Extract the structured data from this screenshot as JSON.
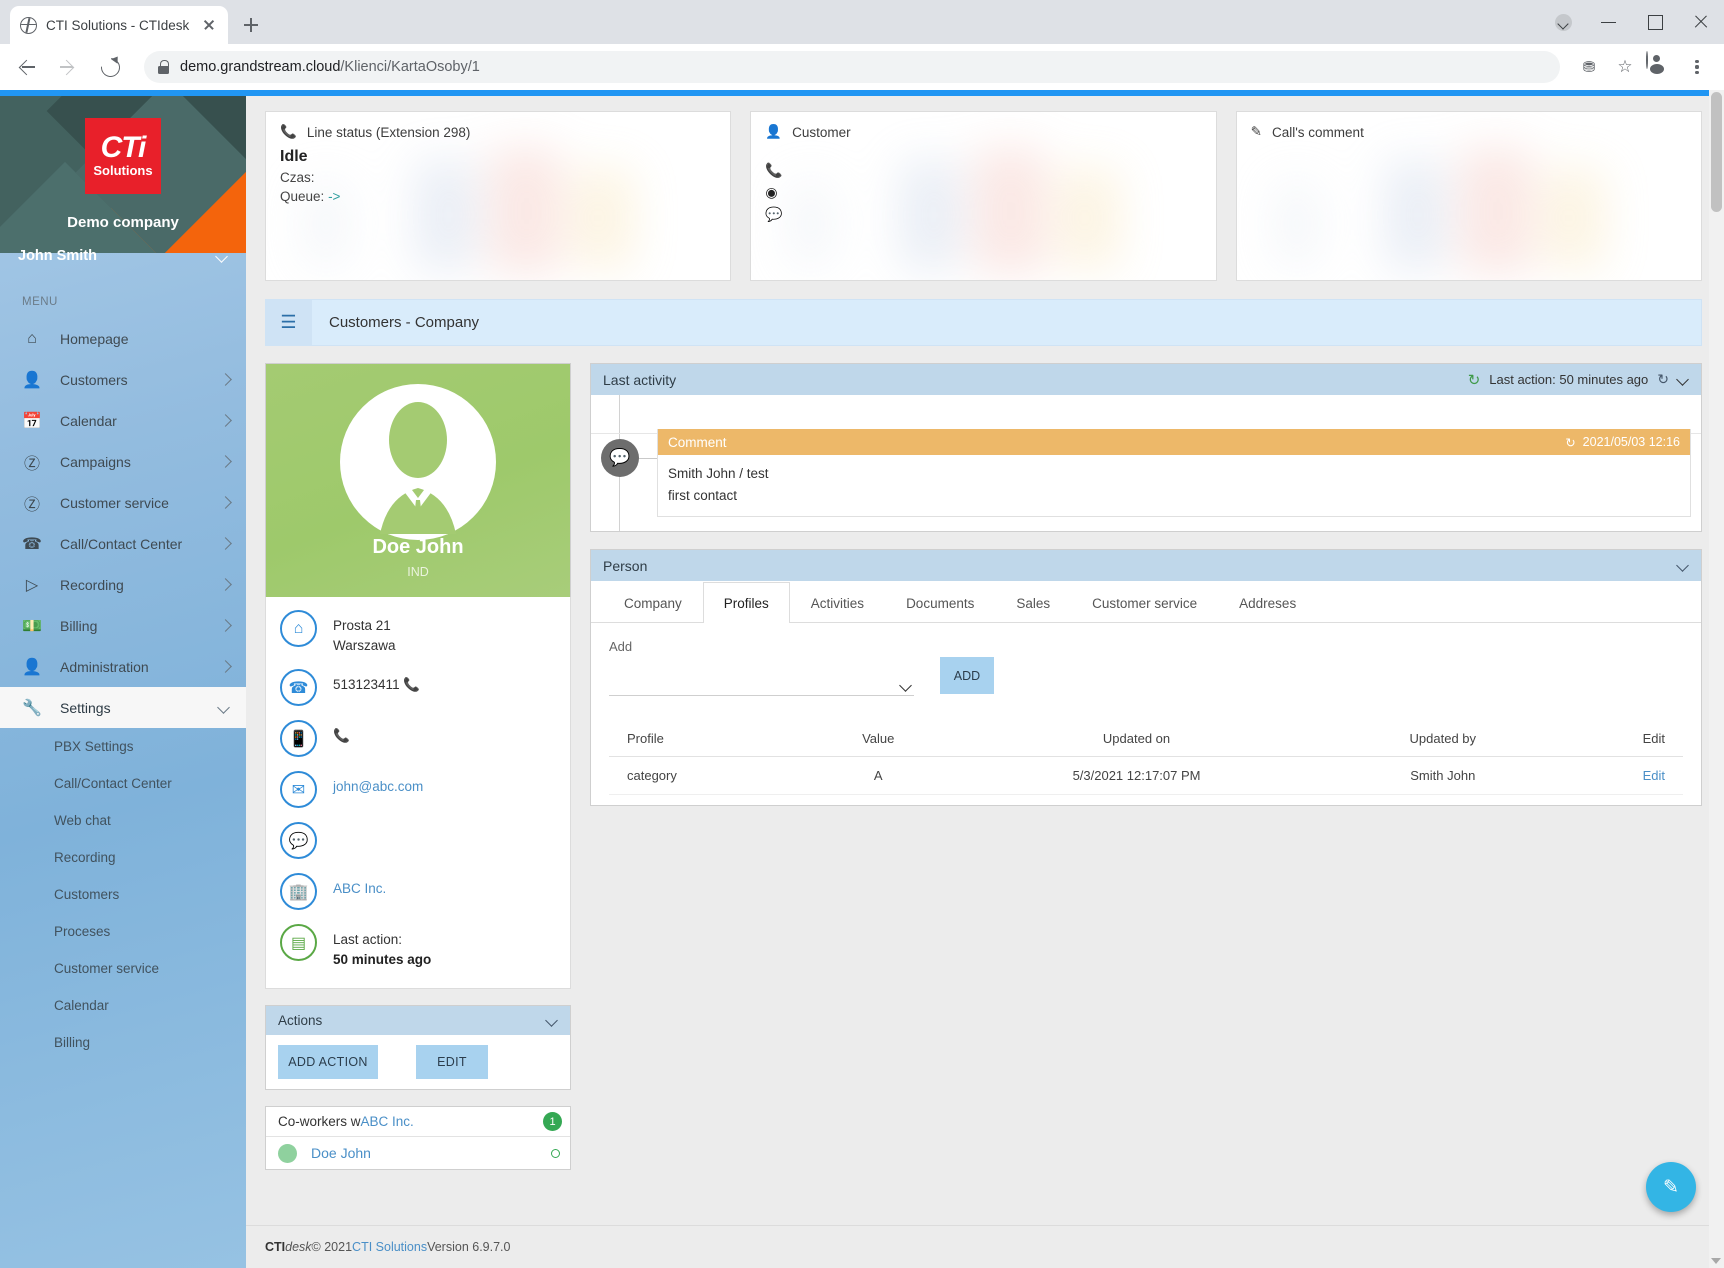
{
  "browser": {
    "tab_title": "CTI Solutions - CTIdesk",
    "url_prefix": "demo.grandstream.cloud",
    "url_path": "/Klienci/KartaOsoby/1",
    "new_tab_label": "+"
  },
  "sidebar": {
    "logo_line1": "CTi",
    "logo_line2": "Solutions",
    "company": "Demo company",
    "user": "John Smith",
    "menu_label": "MENU",
    "items": [
      {
        "label": "Homepage",
        "icon": "home-icon",
        "arrow": false
      },
      {
        "label": "Customers",
        "icon": "user-icon",
        "arrow": true
      },
      {
        "label": "Calendar",
        "icon": "calendar-icon",
        "arrow": true
      },
      {
        "label": "Campaigns",
        "icon": "dollar-icon",
        "arrow": true
      },
      {
        "label": "Customer service",
        "icon": "dollar-icon",
        "arrow": true
      },
      {
        "label": "Call/Contact Center",
        "icon": "phone-transfer-icon",
        "arrow": true
      },
      {
        "label": "Recording",
        "icon": "play-icon",
        "arrow": true
      },
      {
        "label": "Billing",
        "icon": "money-icon",
        "arrow": true
      },
      {
        "label": "Administration",
        "icon": "user-check-icon",
        "arrow": true
      },
      {
        "label": "Settings",
        "icon": "wrench-icon",
        "arrow": true,
        "active": true
      }
    ],
    "subitems": [
      "PBX Settings",
      "Call/Contact Center",
      "Web chat",
      "Recording",
      "Customers",
      "Proceses",
      "Customer service",
      "Calendar",
      "Billing"
    ]
  },
  "cards": {
    "line_status": {
      "title": "Line status (Extension 298)",
      "status": "Idle",
      "time_label": "Czas:",
      "queue_label": "Queue:",
      "queue_value": "->"
    },
    "customer": {
      "title": "Customer"
    },
    "call_comment": {
      "title": "Call's comment"
    }
  },
  "breadcrumb": {
    "text": "Customers - Company"
  },
  "profile": {
    "name": "Doe John",
    "type": "IND",
    "rows": [
      {
        "icon": "home-address-icon",
        "line1": "Prosta 21",
        "line2": "Warszawa",
        "link": false
      },
      {
        "icon": "landline-phone-icon",
        "line1": "513123411",
        "dial": true
      },
      {
        "icon": "mobile-phone-icon",
        "line1": "",
        "dial": true
      },
      {
        "icon": "email-icon",
        "line1": "john@abc.com",
        "link": true
      },
      {
        "icon": "chat-icon",
        "line1": ""
      },
      {
        "icon": "building-icon",
        "line1": "ABC Inc.",
        "link": true
      },
      {
        "icon": "last-action-icon",
        "line1": "Last action:",
        "line2": "50 minutes ago",
        "green": true
      }
    ]
  },
  "actions_panel": {
    "title": "Actions",
    "add_action_label": "ADD ACTION",
    "edit_label": "EDIT"
  },
  "coworkers": {
    "title_prefix": "Co-workers w ",
    "company_link": "ABC Inc.",
    "count": "1",
    "rows": [
      {
        "name": "Doe John"
      }
    ]
  },
  "last_activity": {
    "title": "Last activity",
    "last_action_label": "Last action: 50 minutes ago",
    "item": {
      "type": "Comment",
      "timestamp": "2021/05/03 12:16",
      "author_line": "Smith John / test",
      "body": "first contact"
    }
  },
  "person": {
    "title": "Person",
    "tabs": [
      {
        "label": "Company",
        "active": false
      },
      {
        "label": "Profiles",
        "active": true
      },
      {
        "label": "Activities",
        "active": false
      },
      {
        "label": "Documents",
        "active": false
      },
      {
        "label": "Sales",
        "active": false
      },
      {
        "label": "Customer service",
        "active": false
      },
      {
        "label": "Addreses",
        "active": false
      }
    ],
    "add_label": "Add",
    "add_button": "ADD",
    "select_value": "",
    "table": {
      "headers": [
        "Profile",
        "Value",
        "Updated on",
        "Updated by",
        "Edit"
      ],
      "rows": [
        {
          "profile": "category",
          "value": "A",
          "updated_on": "5/3/2021 12:17:07 PM",
          "updated_by": "Smith John",
          "edit": "Edit"
        }
      ]
    }
  },
  "footer": {
    "brand_bold": "CTI",
    "brand_rest": "desk",
    "copyright": " © 2021 ",
    "company_link": "CTI Solutions",
    "version": " Version 6.9.7.0"
  },
  "colors": {
    "accent_blue": "#2196f3",
    "panel_header": "#bfd7ea",
    "comment_orange": "#edb869",
    "avatar_green": "#a4cb72",
    "logo_red": "#e8202a"
  }
}
